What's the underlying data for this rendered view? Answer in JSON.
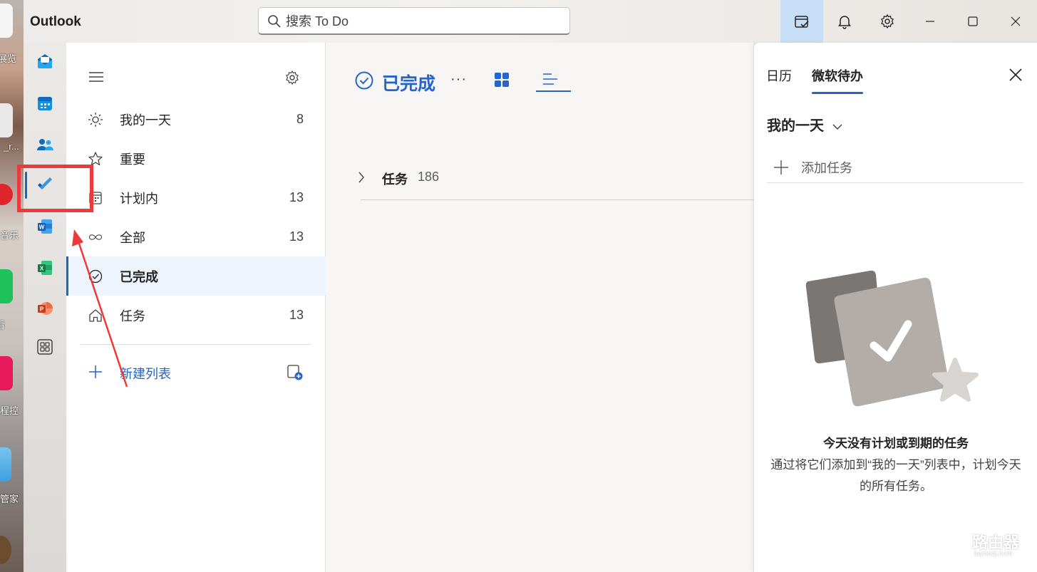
{
  "desktop": {
    "labels": [
      "展览",
      "_r...",
      "音乐",
      "看",
      "程控",
      "管家"
    ]
  },
  "titlebar": {
    "app_title": "Outlook",
    "search_placeholder": "搜索 To Do"
  },
  "rail": {
    "items": [
      "mail-icon",
      "calendar-icon",
      "people-icon",
      "todo-icon",
      "word-icon",
      "excel-icon",
      "powerpoint-icon",
      "more-apps-icon"
    ],
    "active": "todo-icon"
  },
  "nav": {
    "items": [
      {
        "label": "我的一天",
        "count": "8",
        "icon": "sun-icon"
      },
      {
        "label": "重要",
        "count": "",
        "icon": "star-icon"
      },
      {
        "label": "计划内",
        "count": "13",
        "icon": "calendar-grid-icon"
      },
      {
        "label": "全部",
        "count": "13",
        "icon": "infinity-icon"
      },
      {
        "label": "已完成",
        "count": "",
        "icon": "check-circle-icon"
      },
      {
        "label": "任务",
        "count": "13",
        "icon": "home-icon"
      }
    ],
    "selected_index": 4,
    "new_list_label": "新建列表"
  },
  "main": {
    "title": "已完成",
    "more_label": "···",
    "group": {
      "label": "任务",
      "count": "186"
    }
  },
  "side": {
    "tabs": [
      "日历",
      "微软待办"
    ],
    "active_tab": "微软待办",
    "section_title": "我的一天",
    "add_task_label": "添加任务",
    "empty_title": "今天没有计划或到期的任务",
    "empty_desc": "通过将它们添加到“我的一天”列表中，计划今天的所有任务。"
  },
  "watermark": {
    "text": "路由器",
    "sub": "luyouqi.com"
  },
  "colors": {
    "accent": "#2564cf",
    "annotation": "#ea3a3d"
  }
}
